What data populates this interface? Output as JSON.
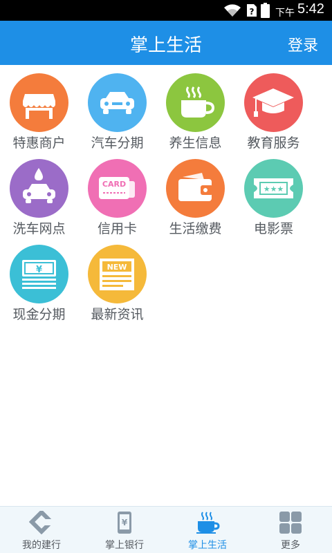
{
  "status_bar": {
    "ampm": "下午",
    "time": "5:42",
    "icons": [
      "wifi-icon",
      "sim-icon",
      "battery-icon"
    ]
  },
  "header": {
    "title": "掌上生活",
    "login_label": "登录",
    "background_color": "#1e8fe6"
  },
  "services": [
    {
      "label": "特惠商户",
      "icon": "storefront-icon",
      "color": "#f47c3c"
    },
    {
      "label": "汽车分期",
      "icon": "car-icon",
      "color": "#4fb3f0"
    },
    {
      "label": "养生信息",
      "icon": "coffee-cup-icon",
      "color": "#8cc63f"
    },
    {
      "label": "教育服务",
      "icon": "graduation-cap-icon",
      "color": "#ee5b5b"
    },
    {
      "label": "洗车网点",
      "icon": "car-wash-icon",
      "color": "#9b6cc8"
    },
    {
      "label": "信用卡",
      "icon": "credit-card-icon",
      "color": "#f06fb4"
    },
    {
      "label": "生活缴费",
      "icon": "wallet-icon",
      "color": "#f47c3c"
    },
    {
      "label": "电影票",
      "icon": "movie-ticket-icon",
      "color": "#5ccbb2"
    },
    {
      "label": "现金分期",
      "icon": "cash-icon",
      "color": "#3bbfd6"
    },
    {
      "label": "最新资讯",
      "icon": "newspaper-icon",
      "color": "#f5b93a"
    }
  ],
  "icon_text": {
    "card": "CARD",
    "new": "NEW",
    "yen": "¥",
    "stars": "★★★"
  },
  "bottom_nav": [
    {
      "label": "我的建行",
      "icon": "ccb-logo-icon",
      "active": false
    },
    {
      "label": "掌上银行",
      "icon": "phone-yen-icon",
      "active": false
    },
    {
      "label": "掌上生活",
      "icon": "coffee-cup-icon",
      "active": true
    },
    {
      "label": "更多",
      "icon": "grid-more-icon",
      "active": false
    }
  ],
  "colors": {
    "accent": "#1e8fe6",
    "nav_inactive": "#8a9aa8",
    "label_text": "#555a60"
  }
}
